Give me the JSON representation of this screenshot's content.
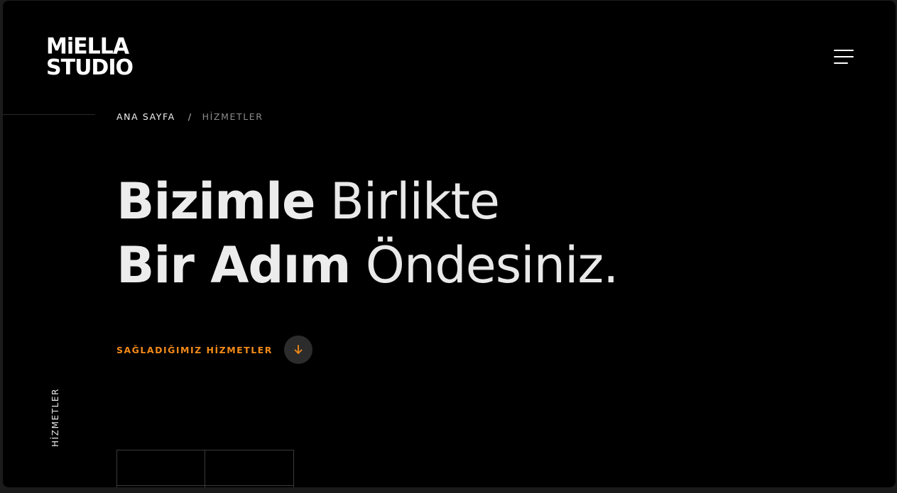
{
  "logo": {
    "line1": "MiELLA",
    "line2": "STUDIO"
  },
  "menu": {
    "icon": "hamburger-menu-icon"
  },
  "breadcrumb": {
    "home": "ANA SAYFA",
    "separator": "/",
    "current": "HİZMETLER"
  },
  "hero": {
    "line1_bold": "Bizimle",
    "line1_light": "Birlikte",
    "line2_bold": "Bir Adım",
    "line2_light": "Öndesiniz."
  },
  "services_link": {
    "label": "SAĞLADIĞIMIZ HİZMETLER",
    "icon": "arrow-down-icon"
  },
  "side_label": "HİZMETLER",
  "colors": {
    "background": "#000000",
    "accent": "#f28a19",
    "text": "#ececec",
    "muted": "#8c8c8c"
  }
}
